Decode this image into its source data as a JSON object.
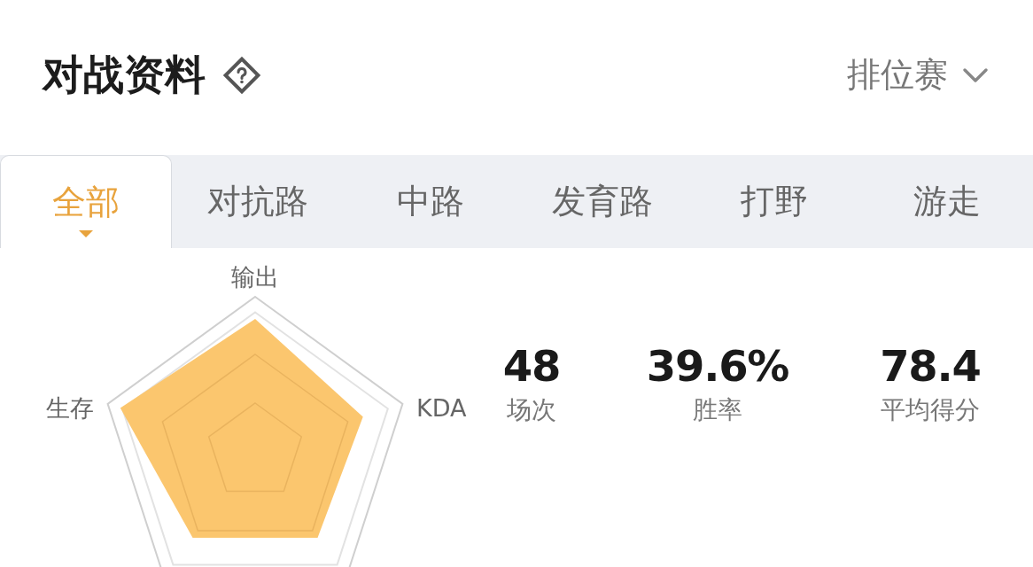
{
  "header": {
    "title": "对战资料",
    "mode_selector": "排位赛"
  },
  "tabs": [
    {
      "label": "全部",
      "selected": true
    },
    {
      "label": "对抗路",
      "selected": false
    },
    {
      "label": "中路",
      "selected": false
    },
    {
      "label": "发育路",
      "selected": false
    },
    {
      "label": "打野",
      "selected": false
    },
    {
      "label": "游走",
      "selected": false
    }
  ],
  "radar": {
    "axis_labels": [
      "输出",
      "KDA",
      "生存"
    ]
  },
  "stats": [
    {
      "value": "48",
      "label": "场次"
    },
    {
      "value": "39.6%",
      "label": "胜率"
    },
    {
      "value": "78.4",
      "label": "平均得分"
    }
  ]
}
